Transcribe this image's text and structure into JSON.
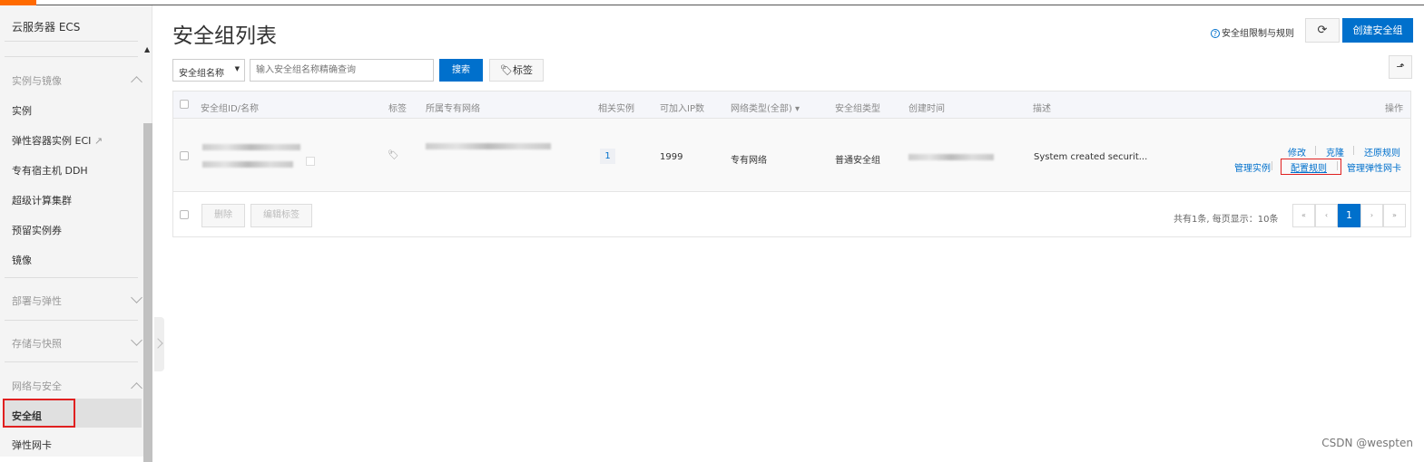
{
  "sidebar": {
    "title": "云服务器 ECS",
    "groups": {
      "instances": "实例与镜像",
      "deploy": "部署与弹性",
      "storage": "存储与快照",
      "network": "网络与安全"
    },
    "items": {
      "instance": "实例",
      "eci": "弹性容器实例 ECI",
      "ddh": "专有宿主机 DDH",
      "scc": "超级计算集群",
      "ri": "预留实例券",
      "image": "镜像",
      "sg": "安全组",
      "eni": "弹性网卡"
    }
  },
  "header": {
    "title": "安全组列表",
    "help_link": "安全组限制与规则",
    "create_button": "创建安全组"
  },
  "search": {
    "field_select": "安全组名称",
    "placeholder": "输入安全组名称精确查询",
    "search_button": "搜索",
    "tag_button": "标签"
  },
  "table": {
    "columns": [
      "安全组ID/名称",
      "标签",
      "所属专有网络",
      "相关实例",
      "可加入IP数",
      "网络类型(全部)",
      "安全组类型",
      "创建时间",
      "描述",
      "操作"
    ],
    "rows": [
      {
        "related_instances": "1",
        "ip_count": "1999",
        "network_type": "专有网络",
        "sg_type": "普通安全组",
        "description": "System created securit...",
        "actions": [
          "修改",
          "克隆",
          "还原规则",
          "管理实例",
          "配置规则",
          "管理弹性网卡"
        ]
      }
    ],
    "footer": {
      "delete_button": "删除",
      "edit_tags_button": "编辑标签",
      "summary": "共有1条, 每页显示：10条"
    },
    "pagination": {
      "first": "«",
      "prev": "‹",
      "current": "1",
      "next": "›",
      "last": "»"
    }
  },
  "watermark": "CSDN @wespten"
}
